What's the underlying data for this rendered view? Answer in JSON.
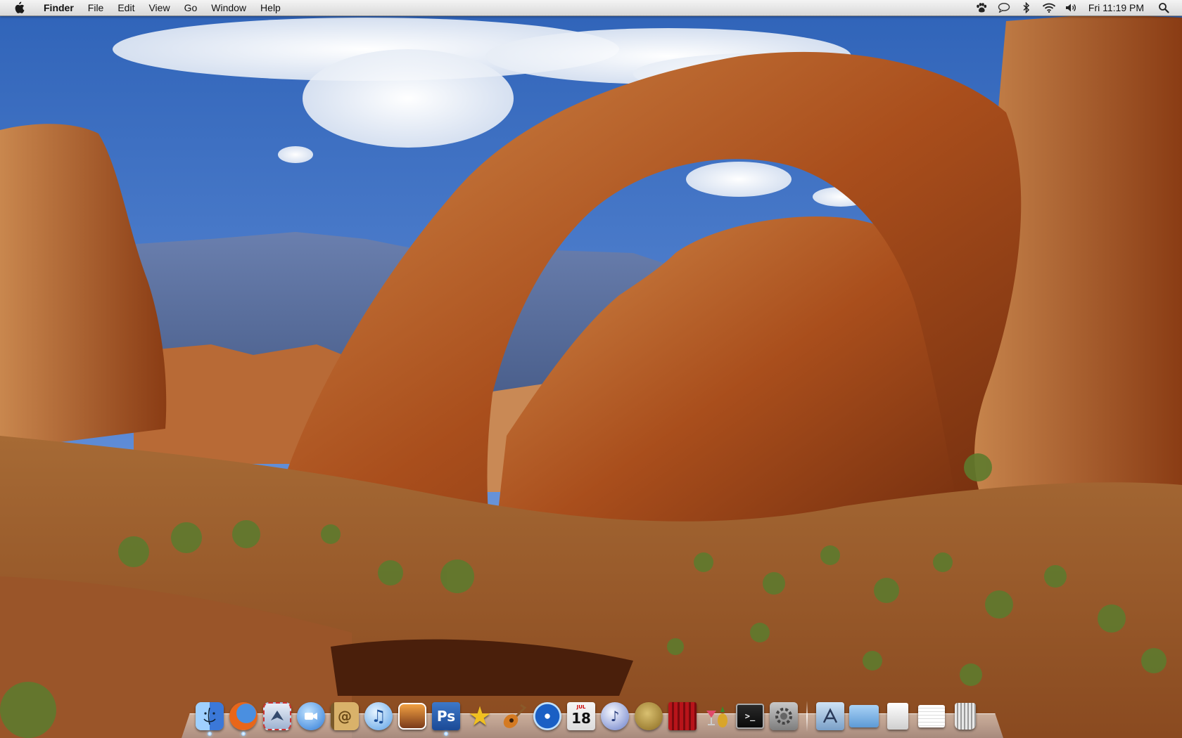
{
  "menubar": {
    "app_name": "Finder",
    "menus": [
      "File",
      "Edit",
      "View",
      "Go",
      "Window",
      "Help"
    ],
    "clock": "Fri 11:19 PM",
    "status_icons": [
      "growl-paw-icon",
      "ichat-status-icon",
      "bluetooth-icon",
      "wifi-icon",
      "volume-icon",
      "spotlight-search-icon"
    ]
  },
  "dock": {
    "apps": [
      {
        "name": "Finder",
        "icon": "finder-icon"
      },
      {
        "name": "Firefox",
        "icon": "firefox-icon"
      },
      {
        "name": "Mail",
        "icon": "mail-icon"
      },
      {
        "name": "iChat",
        "icon": "ichat-icon"
      },
      {
        "name": "Address Book",
        "icon": "address-book-icon"
      },
      {
        "name": "iTunes",
        "icon": "itunes-icon"
      },
      {
        "name": "iPhoto",
        "icon": "iphoto-icon"
      },
      {
        "name": "Photoshop",
        "icon": "photoshop-icon",
        "label": "Ps"
      },
      {
        "name": "iMovie",
        "icon": "imovie-icon"
      },
      {
        "name": "GarageBand",
        "icon": "garageband-icon"
      },
      {
        "name": "DVD Player",
        "icon": "dvd-player-icon"
      },
      {
        "name": "iCal",
        "icon": "ical-icon",
        "month": "JUL",
        "day": "18"
      },
      {
        "name": "iTunes Helper",
        "icon": "music-player-icon"
      },
      {
        "name": "Adium",
        "icon": "adium-icon"
      },
      {
        "name": "Photo Booth",
        "icon": "photo-booth-icon"
      },
      {
        "name": "Cocktail",
        "icon": "cocktail-icon"
      },
      {
        "name": "Terminal",
        "icon": "terminal-icon",
        "label": ">_"
      },
      {
        "name": "System Preferences",
        "icon": "system-preferences-icon"
      }
    ],
    "stacks": [
      {
        "name": "Applications",
        "icon": "applications-stack-icon"
      },
      {
        "name": "Documents",
        "icon": "documents-folder-icon"
      },
      {
        "name": "Downloads",
        "icon": "downloads-stack-icon"
      },
      {
        "name": "Files",
        "icon": "files-stack-icon"
      },
      {
        "name": "Trash",
        "icon": "trash-icon"
      }
    ]
  },
  "colors": {
    "sky": "#4c7ccc",
    "rock": "#b4571f",
    "accent_blue": "#3a78d8"
  }
}
